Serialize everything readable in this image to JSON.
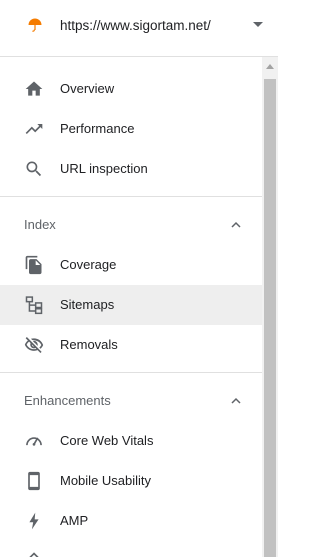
{
  "property": {
    "url": "https://www.sigortam.net/",
    "favicon_icon": "umbrella-icon",
    "dropdown_icon": "caret-down-icon"
  },
  "nav": {
    "top_items": [
      {
        "label": "Overview",
        "icon": "home-icon"
      },
      {
        "label": "Performance",
        "icon": "trending-up-icon"
      },
      {
        "label": "URL inspection",
        "icon": "search-icon"
      }
    ],
    "sections": [
      {
        "title": "Index",
        "collapse_icon": "chevron-up-icon",
        "items": [
          {
            "label": "Coverage",
            "icon": "file-copy-icon"
          },
          {
            "label": "Sitemaps",
            "icon": "sitemap-icon",
            "active": true
          },
          {
            "label": "Removals",
            "icon": "eye-off-icon"
          }
        ]
      },
      {
        "title": "Enhancements",
        "collapse_icon": "chevron-up-icon",
        "items": [
          {
            "label": "Core Web Vitals",
            "icon": "speedometer-icon"
          },
          {
            "label": "Mobile Usability",
            "icon": "smartphone-icon"
          },
          {
            "label": "AMP",
            "icon": "lightning-icon"
          }
        ]
      }
    ]
  },
  "colors": {
    "active_bg": "#eeeeee",
    "icon": "#5f6368",
    "favicon": "#f57c00",
    "divider": "#e0e0e0"
  }
}
